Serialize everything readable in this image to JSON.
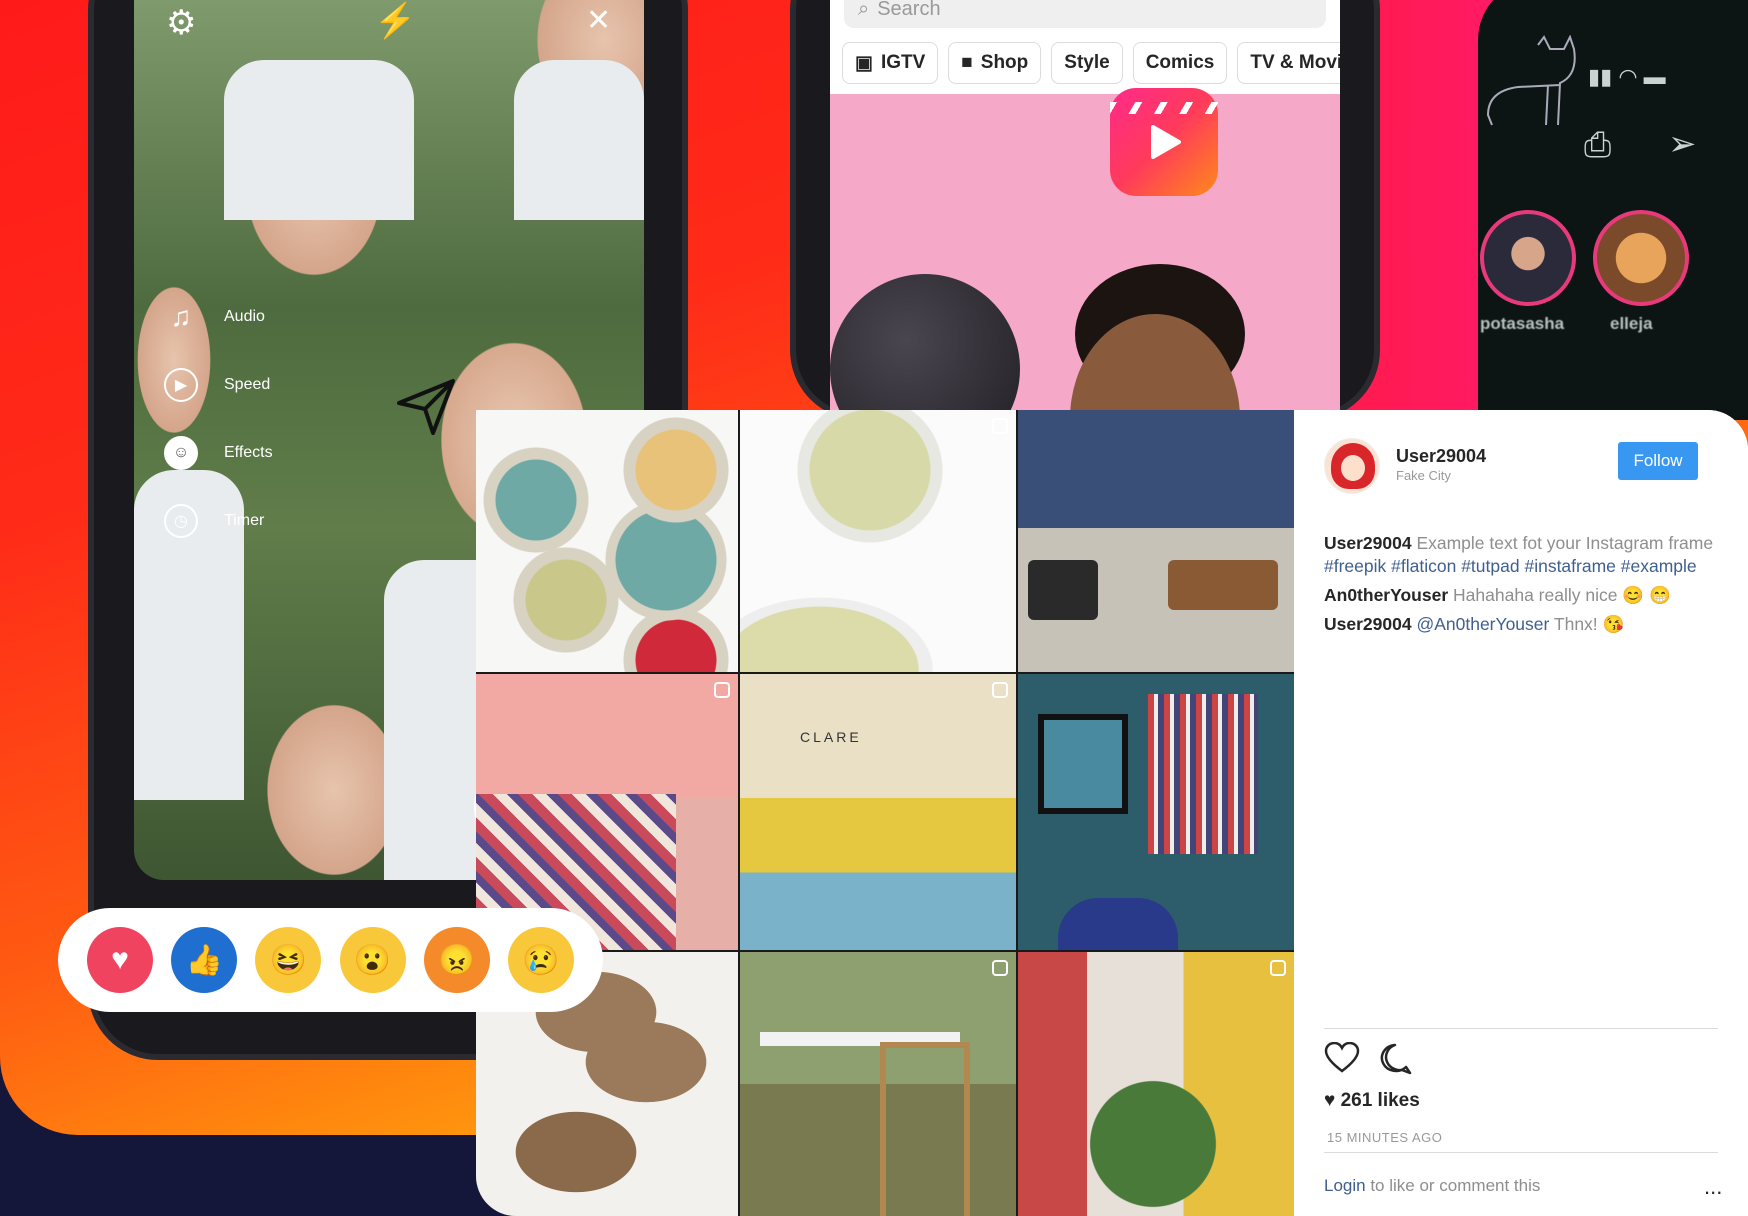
{
  "colors": {
    "gradient_red": "#ff1a1a",
    "gradient_yellow": "#ffc90a",
    "navy_background": "#14163a",
    "follow_blue": "#3897f0",
    "hashtag_blue": "#3f5f8f"
  },
  "camera": {
    "top_icons": [
      "gear-icon",
      "flash-off-icon",
      "close-icon"
    ],
    "menu": [
      {
        "icon": "music-note-icon",
        "label": "Audio"
      },
      {
        "icon": "speed-icon",
        "label": "Speed"
      },
      {
        "icon": "effects-icon",
        "label": "Effects"
      },
      {
        "icon": "timer-icon",
        "label": "Timer"
      }
    ]
  },
  "explore": {
    "search_placeholder": "Search",
    "chips": [
      {
        "icon": "igtv-icon",
        "label": "IGTV"
      },
      {
        "icon": "shop-bag-icon",
        "label": "Shop"
      },
      {
        "label": "Style"
      },
      {
        "label": "Comics"
      },
      {
        "label": "TV & Movie"
      }
    ]
  },
  "stories": [
    {
      "name": "potasasha"
    },
    {
      "name": "elleja"
    }
  ],
  "post": {
    "username": "User29004",
    "location": "Fake City",
    "follow_label": "Follow",
    "caption_user": "User29004",
    "caption_text": "Example text fot your Instagram frame",
    "caption_hashtags": [
      "#freepik",
      "#flaticon",
      "#tutpad",
      "#instaframe",
      "#example"
    ],
    "comments": [
      {
        "user": "An0therYouser",
        "text": "Hahahaha really nice",
        "emoji": "😊 😁"
      },
      {
        "user": "User29004",
        "mention": "@An0therYouser",
        "text": "Thnx!",
        "emoji": "😘"
      }
    ],
    "likes": "261 likes",
    "time_ago": "15 MINUTES AGO",
    "login_link": "Login",
    "login_suffix": " to like or comment this",
    "more": "..."
  },
  "reactions": [
    {
      "name": "love-reaction",
      "glyph": "♥",
      "color": "#f0435f"
    },
    {
      "name": "like-reaction",
      "glyph": "👍",
      "color": "#1f6fd1"
    },
    {
      "name": "haha-reaction",
      "glyph": "😆",
      "color": "#f8c83a"
    },
    {
      "name": "wow-reaction",
      "glyph": "😮",
      "color": "#f8c83a"
    },
    {
      "name": "angry-reaction",
      "glyph": "😠",
      "color": "#f48a2a"
    },
    {
      "name": "sad-reaction",
      "glyph": "😢",
      "color": "#f8c83a"
    }
  ]
}
